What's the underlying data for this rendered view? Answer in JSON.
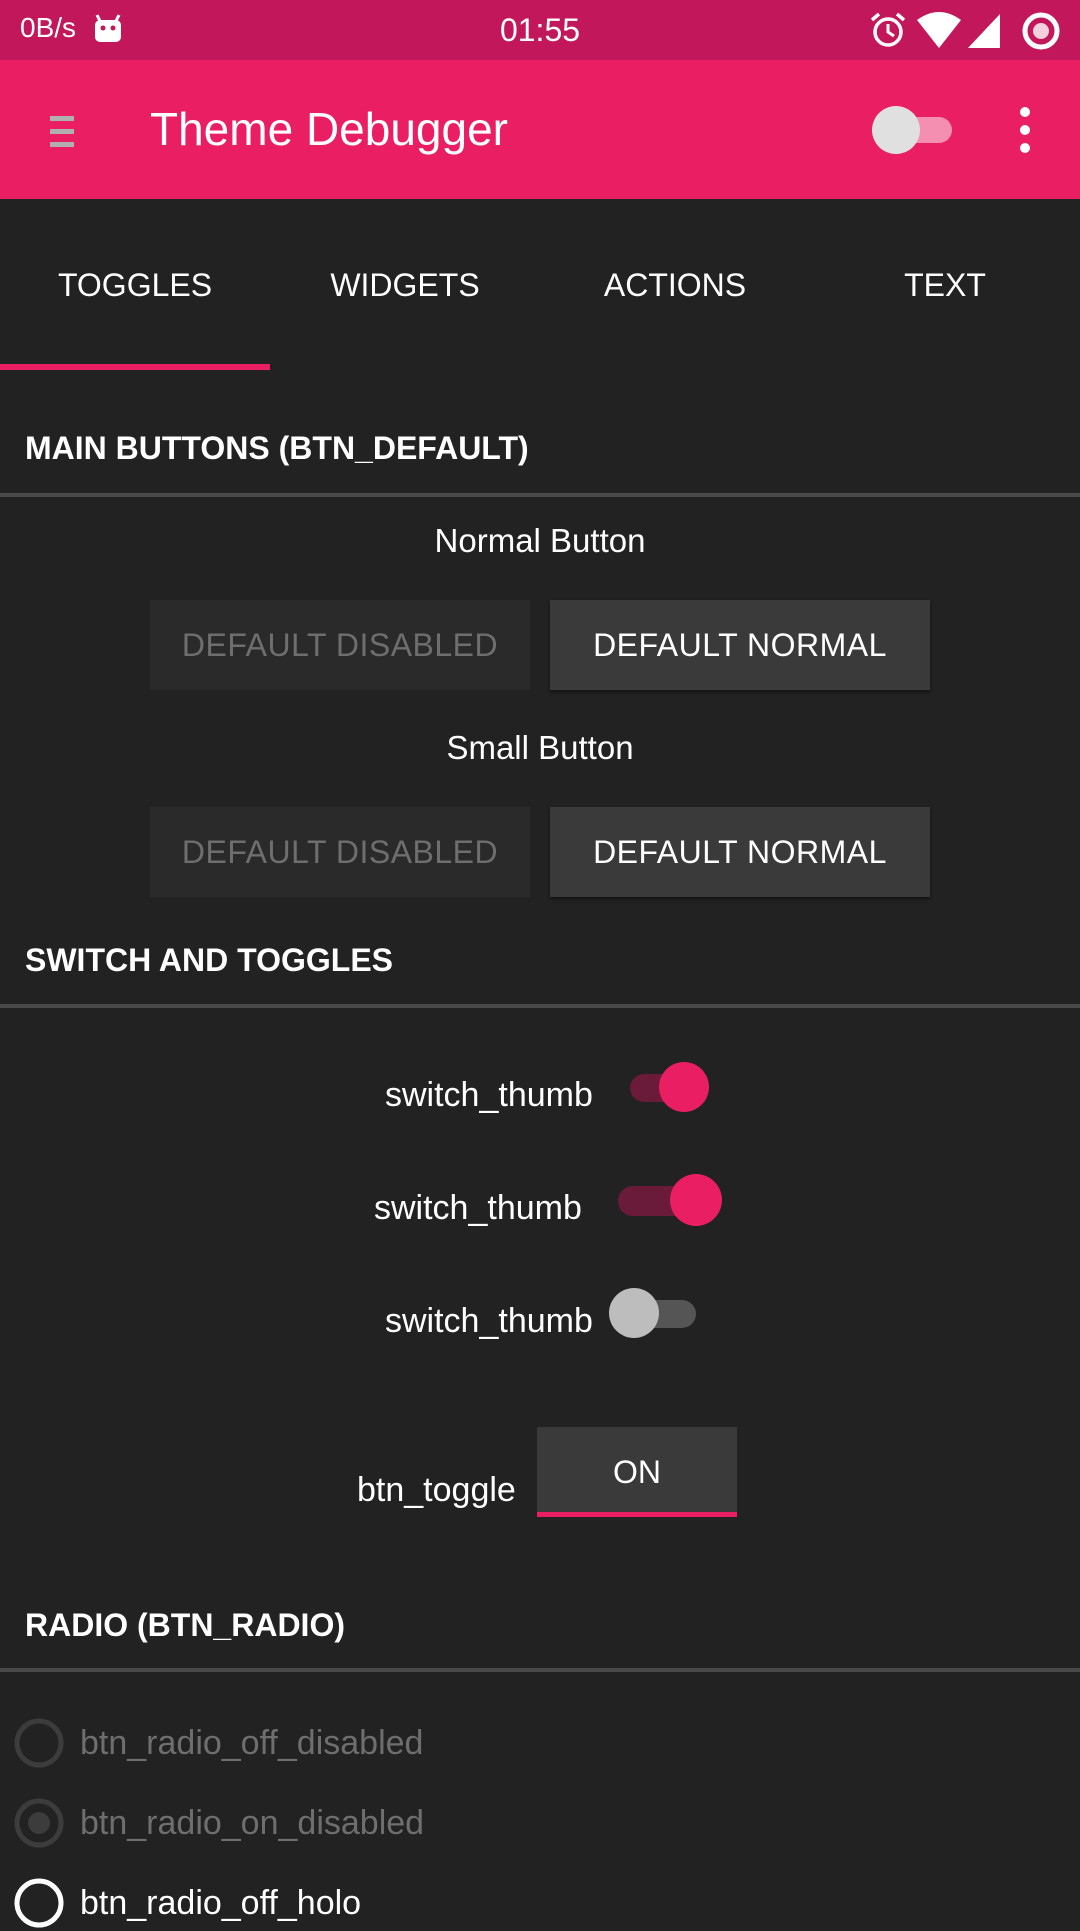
{
  "status_bar": {
    "net_speed": "0B/s",
    "time": "01:55",
    "icons": [
      "android-icon",
      "alarm-icon",
      "wifi-icon",
      "signal-icon",
      "sync-icon"
    ]
  },
  "app_bar": {
    "title": "Theme Debugger",
    "theme_toggle_on": false,
    "accent": "#e91e63",
    "status_color": "#c2185b"
  },
  "tabs": [
    {
      "label": "TOGGLES",
      "selected": true
    },
    {
      "label": "WIDGETS",
      "selected": false
    },
    {
      "label": "ACTIONS",
      "selected": false
    },
    {
      "label": "TEXT",
      "selected": false
    }
  ],
  "main_buttons": {
    "title": "MAIN BUTTONS (BTN_DEFAULT)",
    "normal_caption": "Normal Button",
    "small_caption": "Small Button",
    "disabled_label": "DEFAULT DISABLED",
    "normal_label": "DEFAULT NORMAL"
  },
  "switches": {
    "title": "SWITCH AND TOGGLES",
    "items": [
      {
        "label": "switch_thumb",
        "on": true
      },
      {
        "label": "switch_thumb",
        "on": true
      },
      {
        "label": "switch_thumb",
        "on": false
      }
    ],
    "toggle_label": "btn_toggle",
    "toggle_value": "ON"
  },
  "radio": {
    "title": "RADIO (BTN_RADIO)",
    "items": [
      {
        "label": "btn_radio_off_disabled",
        "checked": false,
        "enabled": false
      },
      {
        "label": "btn_radio_on_disabled",
        "checked": true,
        "enabled": false
      },
      {
        "label": "btn_radio_off_holo",
        "checked": false,
        "enabled": true
      }
    ]
  }
}
